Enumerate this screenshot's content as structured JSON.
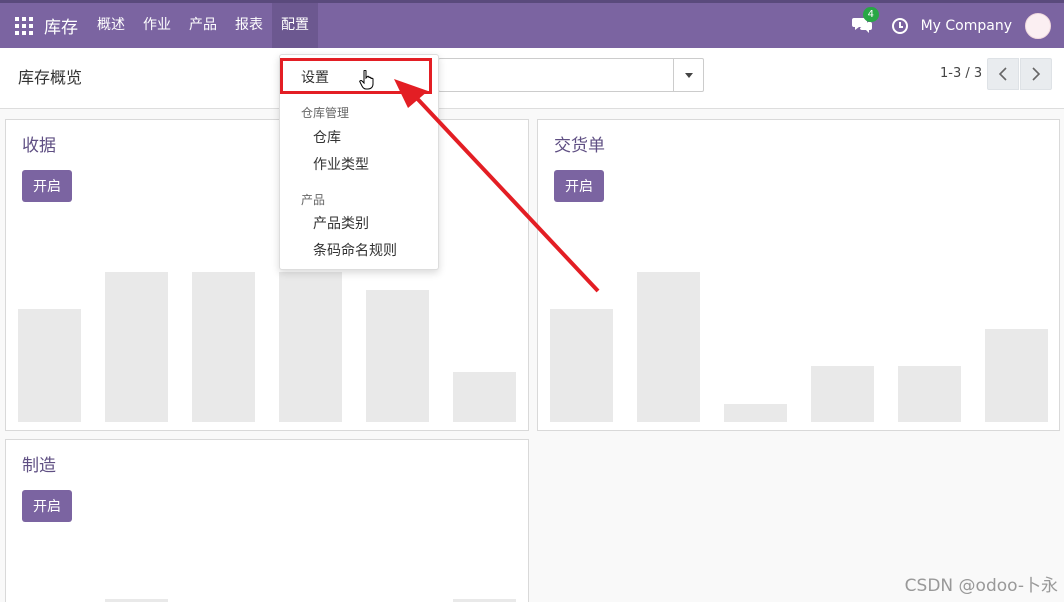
{
  "navbar": {
    "brand": "库存",
    "items": [
      "概述",
      "作业",
      "产品",
      "报表",
      "配置"
    ],
    "active_item": "配置",
    "chat_badge": "4",
    "company": "My Company",
    "bg_color": "#7b64a1"
  },
  "control_panel": {
    "breadcrumb": "库存概览",
    "pager": "1-3 / 3"
  },
  "dropdown": {
    "settings": "设置",
    "warehouse_header": "仓库管理",
    "warehouse": "仓库",
    "operation_types": "作业类型",
    "product_header": "产品",
    "product_categories": "产品类别",
    "barcode_nomenclature": "条码命名规则"
  },
  "cards": {
    "receipts": {
      "title": "收据",
      "button": "开启",
      "bars": [
        0.75,
        1.0,
        1.0,
        1.0,
        0.88,
        0.33
      ]
    },
    "delivery": {
      "title": "交货单",
      "button": "开启",
      "bars": [
        0.75,
        1.0,
        0.12,
        0.37,
        0.37,
        0.62
      ]
    },
    "manufacturing": {
      "title": "制造",
      "button": "开启",
      "bars": [
        0.0,
        0.06,
        0.0,
        0.0,
        0.0,
        0.06
      ]
    }
  },
  "annotation": {
    "color": "#e31e24"
  },
  "watermark": "CSDN @odoo-卜永"
}
